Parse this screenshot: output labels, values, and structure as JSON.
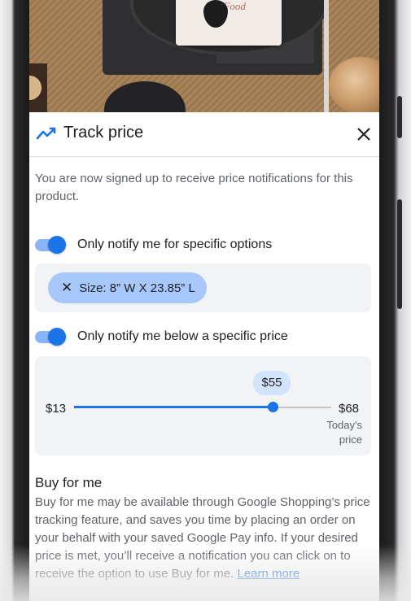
{
  "header": {
    "title": "Track price",
    "trend_icon": "trending-up-icon",
    "close_icon": "close-icon"
  },
  "photo": {
    "book_text": "H   n Food"
  },
  "description": "You are now signed up to receive price notifications for this product.",
  "options_toggle": {
    "label": "Only notify me for specific options",
    "on": true
  },
  "options": {
    "chip_label": "Size: 8” W X 23.85” L",
    "chip_icon": "close-icon"
  },
  "price_toggle": {
    "label": "Only notify me below a specific price",
    "on": true
  },
  "price_slider": {
    "min_label": "$13",
    "max_label": "$68",
    "selected_label": "$55",
    "min_value": 13,
    "max_value": 68,
    "selected_value": 55,
    "max_caption": "Today's price"
  },
  "buy_for_me": {
    "title": "Buy for me",
    "text": "Buy for me may be available through Google Shopping’s price tracking feature, and saves you time by placing an order on your behalf with your saved Google Pay info. If your desired price is met, you’ll receive a notification you can click on to receive the option to use Buy for me.",
    "link": "Learn more"
  },
  "colors": {
    "accent": "#1a73e8",
    "chip": "#a8c7fa",
    "panel": "#f1f3f4"
  }
}
